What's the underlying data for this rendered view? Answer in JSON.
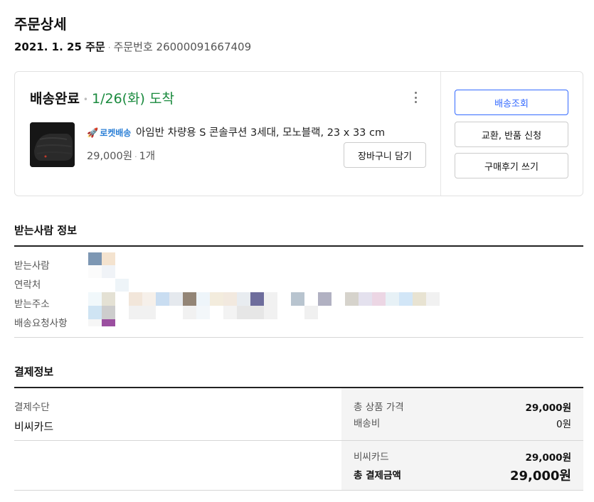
{
  "header": {
    "title": "주문상세",
    "order_date": "2021. 1. 25 주문",
    "order_number": "주문번호 26000091667409"
  },
  "order_card": {
    "status": "배송완료",
    "arrival": "1/26(화) 도착",
    "rocket_label": "로켓배송",
    "product_name": "아임반 차량용 S 콘솔쿠션 3세대, 모노블랙, 23 x 33 cm",
    "price": "29,000원",
    "quantity": "1개",
    "cart_button": "장바구니 담기",
    "actions": {
      "track": "배송조회",
      "exchange": "교환, 반품 신청",
      "review": "구매후기 쓰기"
    },
    "colors": {
      "arrival": "#1a8a3e",
      "primary": "#346aff"
    }
  },
  "recipient": {
    "title": "받는사람 정보",
    "labels": [
      "받는사람",
      "연락처",
      "받는주소",
      "배송요청사항"
    ]
  },
  "payment": {
    "title": "결제정보",
    "method_label": "결제수단",
    "method_value": "비씨카드",
    "total_product_label": "총 상품 가격",
    "total_product_value": "29,000원",
    "shipping_label": "배송비",
    "shipping_value": "0원",
    "card_label": "비씨카드",
    "card_value": "29,000원",
    "total_label": "총 결제금액",
    "total_value": "29,000원"
  }
}
